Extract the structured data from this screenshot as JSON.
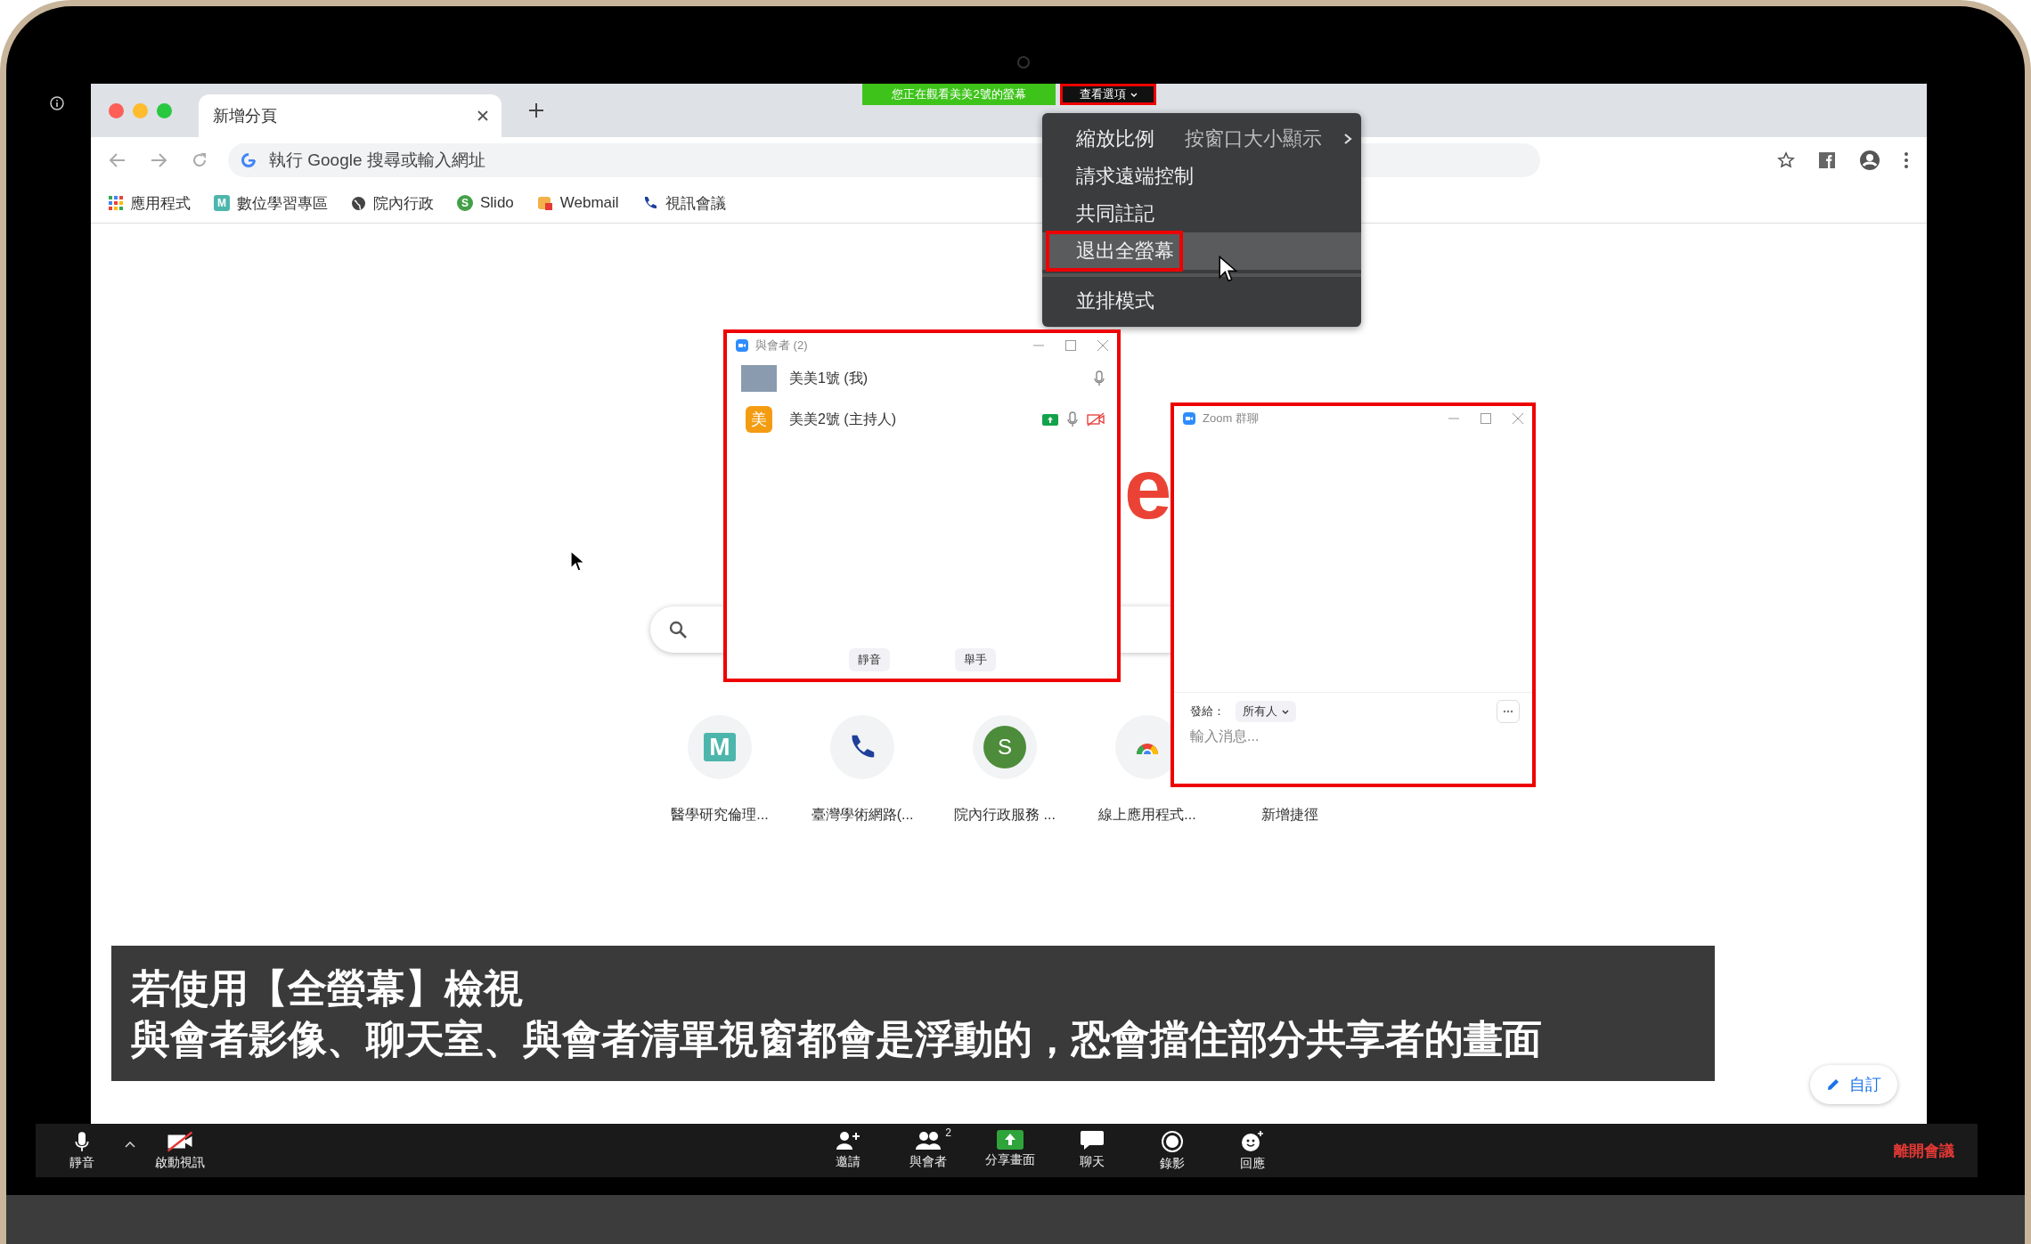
{
  "top_banner": {
    "viewing_text": "您正在觀看美美2號的螢幕",
    "view_options": {
      "label": "查看選項",
      "annotated": true
    }
  },
  "view_menu": {
    "groups": [
      [
        {
          "kind": "submenu",
          "label": "縮放比例",
          "value": "按窗口大小顯示",
          "selected": false,
          "annotated": false
        },
        {
          "kind": "item",
          "label": "請求遠端控制",
          "selected": false,
          "annotated": false
        },
        {
          "kind": "item",
          "label": "共同註記",
          "selected": false,
          "annotated": false
        },
        {
          "kind": "item",
          "label": "退出全螢幕",
          "selected": true,
          "annotated": true
        }
      ],
      [
        {
          "kind": "item",
          "label": "並排模式",
          "selected": false,
          "annotated": false
        }
      ]
    ]
  },
  "browser": {
    "tab": {
      "title": "新增分頁"
    },
    "address": {
      "placeholder": "執行 Google 搜尋或輸入網址"
    },
    "bookmarks": [
      {
        "kind": "apps",
        "label": "應用程式"
      },
      {
        "kind": "letter",
        "letter": "M",
        "color": "#4db6ac",
        "label": "數位學習專區"
      },
      {
        "kind": "globe",
        "label": "院內行政"
      },
      {
        "kind": "letter",
        "letter": "S",
        "color": "#43a047",
        "label": "Slido"
      },
      {
        "kind": "mail",
        "label": "Webmail"
      },
      {
        "kind": "phone",
        "label": "視訊會議"
      }
    ],
    "logo_fragment": "e",
    "shortcuts": [
      {
        "kind": "letter",
        "letter": "M",
        "color": "#4db6ac",
        "label": "醫學研究倫理..."
      },
      {
        "kind": "phone",
        "label": "臺灣學術網路(..."
      },
      {
        "kind": "letter",
        "letter": "S",
        "color": "#4c8c3a",
        "label": "院內行政服務 ..."
      },
      {
        "kind": "chrome",
        "label": "線上應用程式..."
      },
      {
        "kind": "hidden",
        "label": "新增捷徑"
      }
    ],
    "customize": "自訂"
  },
  "participants_window": {
    "title": "與會者 (2)",
    "annotated": true,
    "rows": [
      {
        "name": "美美1號 (我)",
        "kind": "photo",
        "sharing": false,
        "video_off": false
      },
      {
        "name": "美美2號 (主持人)",
        "kind": "letter",
        "avatar_letter": "美",
        "sharing": true,
        "video_off": true
      }
    ],
    "buttons": [
      "靜音",
      "舉手"
    ]
  },
  "chat_window": {
    "title": "Zoom 群聊",
    "annotated": true,
    "to_label": "發給：",
    "recipient": "所有人",
    "placeholder": "輸入消息..."
  },
  "caption": {
    "lines": [
      "若使用【全螢幕】檢視",
      "與會者影像、聊天室、與會者清單視窗都會是浮動的，恐會擋住部分共享者的畫面"
    ]
  },
  "meeting_toolbar": {
    "left": [
      {
        "kind": "mic",
        "label": "靜音"
      },
      {
        "kind": "video_off",
        "label": "啟動視訊"
      }
    ],
    "center": [
      {
        "kind": "invite",
        "label": "邀請"
      },
      {
        "kind": "participants",
        "label": "與會者",
        "count": "2"
      },
      {
        "kind": "share",
        "label": "分享畫面"
      },
      {
        "kind": "chat",
        "label": "聊天"
      },
      {
        "kind": "record",
        "label": "錄影"
      },
      {
        "kind": "reactions",
        "label": "回應"
      }
    ],
    "leave": "離開會議"
  }
}
